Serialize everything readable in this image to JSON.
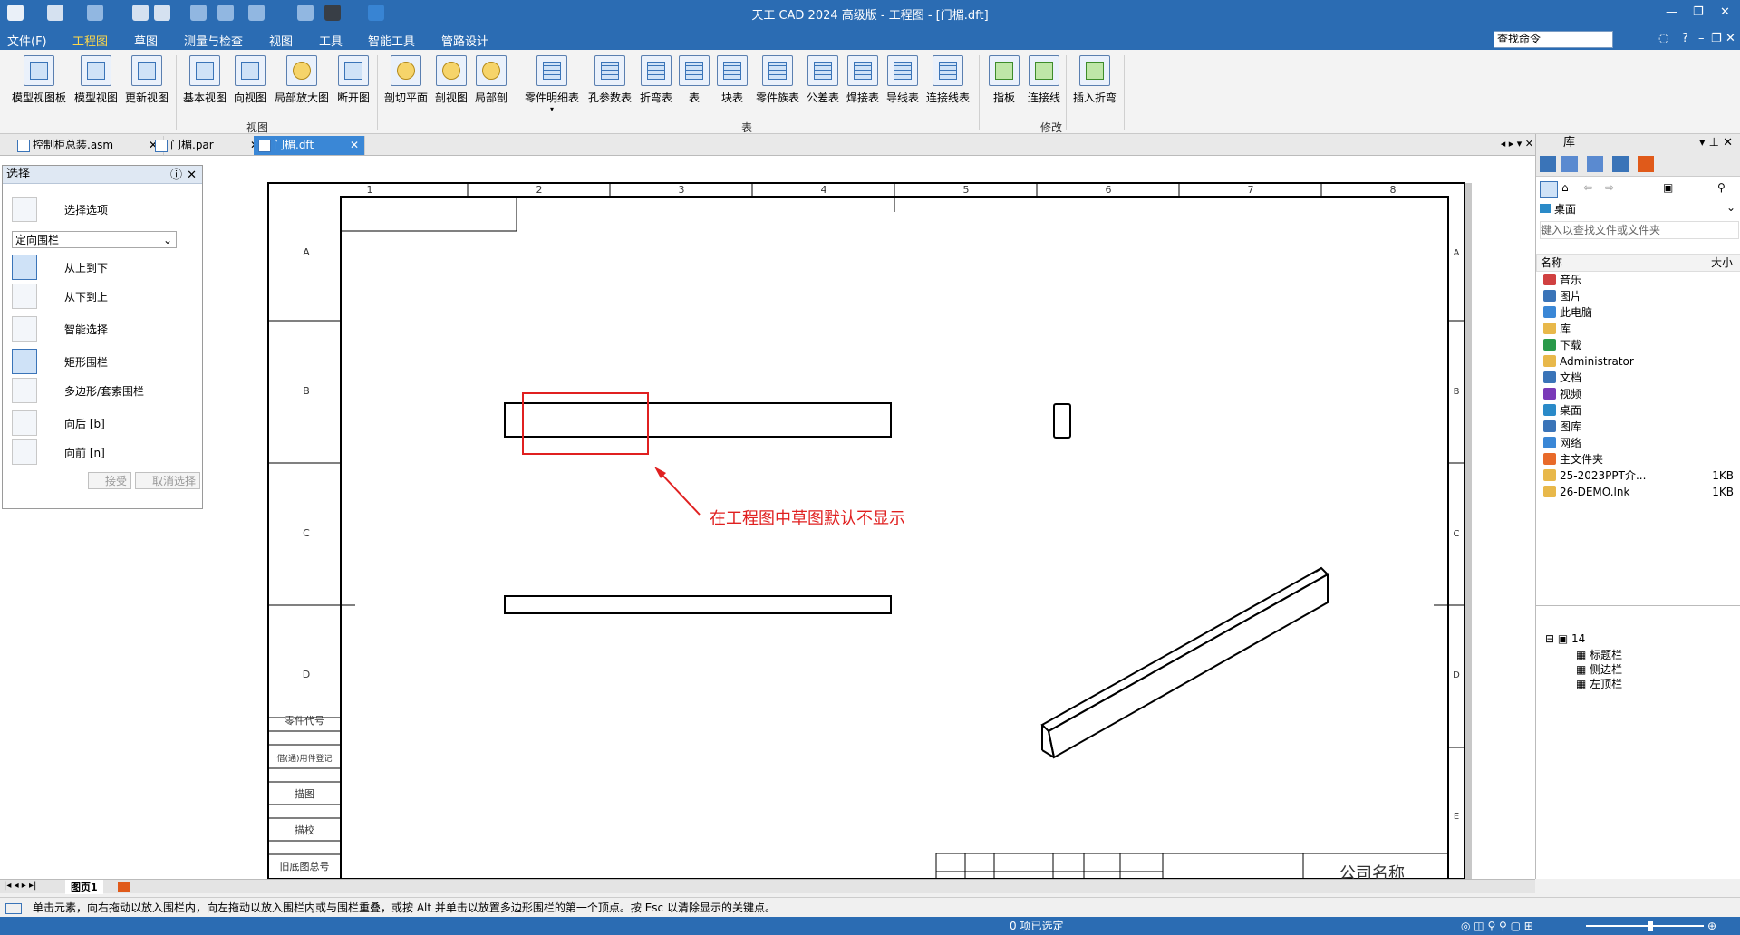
{
  "window": {
    "title": "天工 CAD 2024 高级版 - 工程图 - [门楣.dft]"
  },
  "menu": [
    "文件(F)",
    "工程图",
    "草图",
    "测量与检查",
    "视图",
    "工具",
    "智能工具",
    "管路设计"
  ],
  "search": {
    "placeholder": "查找命令"
  },
  "ribbon": {
    "buttons": [
      "模型视图板",
      "模型视图",
      "更新视图",
      "基本视图",
      "向视图",
      "局部放大图",
      "断开图",
      "剖切平面",
      "剖视图",
      "局部剖",
      "零件明细表",
      "孔参数表",
      "折弯表",
      "表",
      "块表",
      "零件族表",
      "公差表",
      "焊接表",
      "导线表",
      "连接线表",
      "指板",
      "连接线",
      "插入折弯"
    ],
    "groups": [
      "视图",
      "表",
      "修改"
    ]
  },
  "tabs": [
    {
      "label": "控制柜总装.asm"
    },
    {
      "label": "门楣.par"
    },
    {
      "label": "门楣.dft"
    }
  ],
  "select_panel": {
    "title": "选择",
    "options_label": "选择选项",
    "mode": "定向围栏",
    "items": [
      "从上到下",
      "从下到上",
      "智能选择",
      "矩形围栏",
      "多边形/套索围栏",
      "向后 [b]",
      "向前 [n]"
    ],
    "accept": "接受",
    "cancel": "取消选择"
  },
  "drawing": {
    "col_labels": [
      "1",
      "2",
      "3",
      "4",
      "5",
      "6",
      "7",
      "8"
    ],
    "row_labels": [
      "A",
      "B",
      "C",
      "D"
    ],
    "right_row_labels": [
      "A",
      "B",
      "C",
      "D",
      "E"
    ],
    "side_table": [
      "零件代号",
      "借(通)用件登记",
      "描图",
      "描校",
      "旧底图总号"
    ],
    "title_block_text": "公司名称",
    "annotation": "在工程图中草图默认不显示",
    "annotation_color": "#e02020"
  },
  "library": {
    "title": "库",
    "location": "桌面",
    "search_placeholder": "键入以查找文件或文件夹",
    "col_name": "名称",
    "col_size": "大小",
    "items": [
      {
        "name": "音乐",
        "size": "",
        "color": "#d04040"
      },
      {
        "name": "图片",
        "size": "",
        "color": "#3a74b8"
      },
      {
        "name": "此电脑",
        "size": "",
        "color": "#3a87d6"
      },
      {
        "name": "库",
        "size": "",
        "color": "#e8b84a"
      },
      {
        "name": "下载",
        "size": "",
        "color": "#2a9a4a"
      },
      {
        "name": "Administrator",
        "size": "",
        "color": "#e8b84a"
      },
      {
        "name": "文档",
        "size": "",
        "color": "#3a74b8"
      },
      {
        "name": "视频",
        "size": "",
        "color": "#7a3ab8"
      },
      {
        "name": "桌面",
        "size": "",
        "color": "#2a8ac8"
      },
      {
        "name": "图库",
        "size": "",
        "color": "#3a74b8"
      },
      {
        "name": "网络",
        "size": "",
        "color": "#3a87d6"
      },
      {
        "name": "主文件夹",
        "size": "",
        "color": "#e86a2a"
      },
      {
        "name": "25-2023PPT介...",
        "size": "1KB",
        "color": "#e8b84a"
      },
      {
        "name": "26-DEMO.lnk",
        "size": "1KB",
        "color": "#e8b84a"
      }
    ],
    "tree": {
      "root": "14",
      "children": [
        "标题栏",
        "侧边栏",
        "左顶栏"
      ]
    }
  },
  "sheet_tab": "图页1",
  "prompt": "单击元素，向右拖动以放入围栏内，向左拖动以放入围栏内或与围栏重叠，或按 Alt 并单击以放置多边形围栏的第一个顶点。按 Esc 以清除显示的关键点。",
  "status": "0 项已选定"
}
